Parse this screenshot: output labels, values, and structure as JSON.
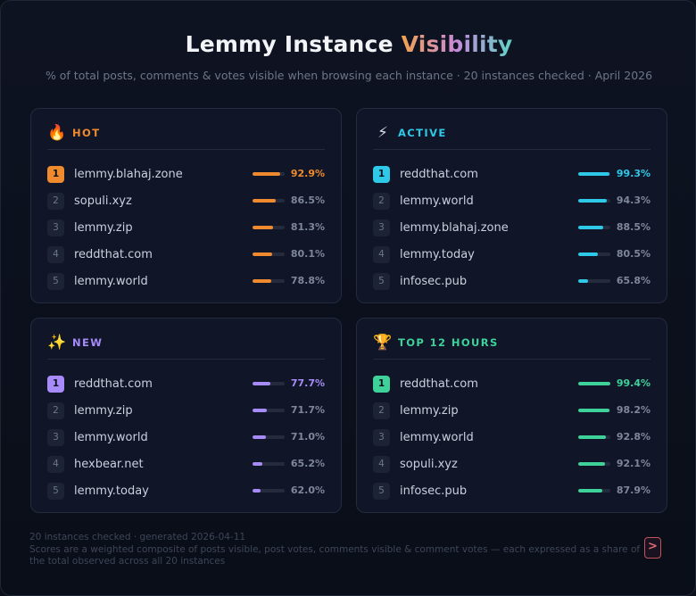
{
  "header": {
    "title_main": "Lemmy Instance",
    "title_accent": "Visibility",
    "subtitle": "% of total posts, comments & votes visible when browsing each instance · 20 instances checked · April 2026"
  },
  "cards": [
    {
      "title": "HOT",
      "icon": "fire-icon",
      "icon_glyph": "🔥",
      "accent": "#f08a2e",
      "rows": [
        {
          "rank": "1",
          "name": "lemmy.blahaj.zone",
          "pct": "92.9%",
          "value": 92.9
        },
        {
          "rank": "2",
          "name": "sopuli.xyz",
          "pct": "86.5%",
          "value": 86.5
        },
        {
          "rank": "3",
          "name": "lemmy.zip",
          "pct": "81.3%",
          "value": 81.3
        },
        {
          "rank": "4",
          "name": "reddthat.com",
          "pct": "80.1%",
          "value": 80.1
        },
        {
          "rank": "5",
          "name": "lemmy.world",
          "pct": "78.8%",
          "value": 78.8
        }
      ]
    },
    {
      "title": "ACTIVE",
      "icon": "lightning-icon",
      "icon_glyph": "⚡",
      "accent": "#2ec9e8",
      "rows": [
        {
          "rank": "1",
          "name": "reddthat.com",
          "pct": "99.3%",
          "value": 99.3
        },
        {
          "rank": "2",
          "name": "lemmy.world",
          "pct": "94.3%",
          "value": 94.3
        },
        {
          "rank": "3",
          "name": "lemmy.blahaj.zone",
          "pct": "88.5%",
          "value": 88.5
        },
        {
          "rank": "4",
          "name": "lemmy.today",
          "pct": "80.5%",
          "value": 80.5
        },
        {
          "rank": "5",
          "name": "infosec.pub",
          "pct": "65.8%",
          "value": 65.8
        }
      ]
    },
    {
      "title": "NEW",
      "icon": "sparkles-icon",
      "icon_glyph": "✨",
      "accent": "#a78bfa",
      "rows": [
        {
          "rank": "1",
          "name": "reddthat.com",
          "pct": "77.7%",
          "value": 77.7
        },
        {
          "rank": "2",
          "name": "lemmy.zip",
          "pct": "71.7%",
          "value": 71.7
        },
        {
          "rank": "3",
          "name": "lemmy.world",
          "pct": "71.0%",
          "value": 71.0
        },
        {
          "rank": "4",
          "name": "hexbear.net",
          "pct": "65.2%",
          "value": 65.2
        },
        {
          "rank": "5",
          "name": "lemmy.today",
          "pct": "62.0%",
          "value": 62.0
        }
      ]
    },
    {
      "title": "TOP 12 HOURS",
      "icon": "trophy-icon",
      "icon_glyph": "🏆",
      "accent": "#3fd19a",
      "rows": [
        {
          "rank": "1",
          "name": "reddthat.com",
          "pct": "99.4%",
          "value": 99.4
        },
        {
          "rank": "2",
          "name": "lemmy.zip",
          "pct": "98.2%",
          "value": 98.2
        },
        {
          "rank": "3",
          "name": "lemmy.world",
          "pct": "92.8%",
          "value": 92.8
        },
        {
          "rank": "4",
          "name": "sopuli.xyz",
          "pct": "92.1%",
          "value": 92.1
        },
        {
          "rank": "5",
          "name": "infosec.pub",
          "pct": "87.9%",
          "value": 87.9
        }
      ]
    }
  ],
  "footer": {
    "line1": "20 instances checked · generated 2026-04-11",
    "line2": "Scores are a weighted composite of posts visible, post votes, comments visible & comment votes — each expressed as a share of the total observed across all 20 instances",
    "logo_icon": "terminal-logo-icon",
    "logo_glyph": ">"
  }
}
